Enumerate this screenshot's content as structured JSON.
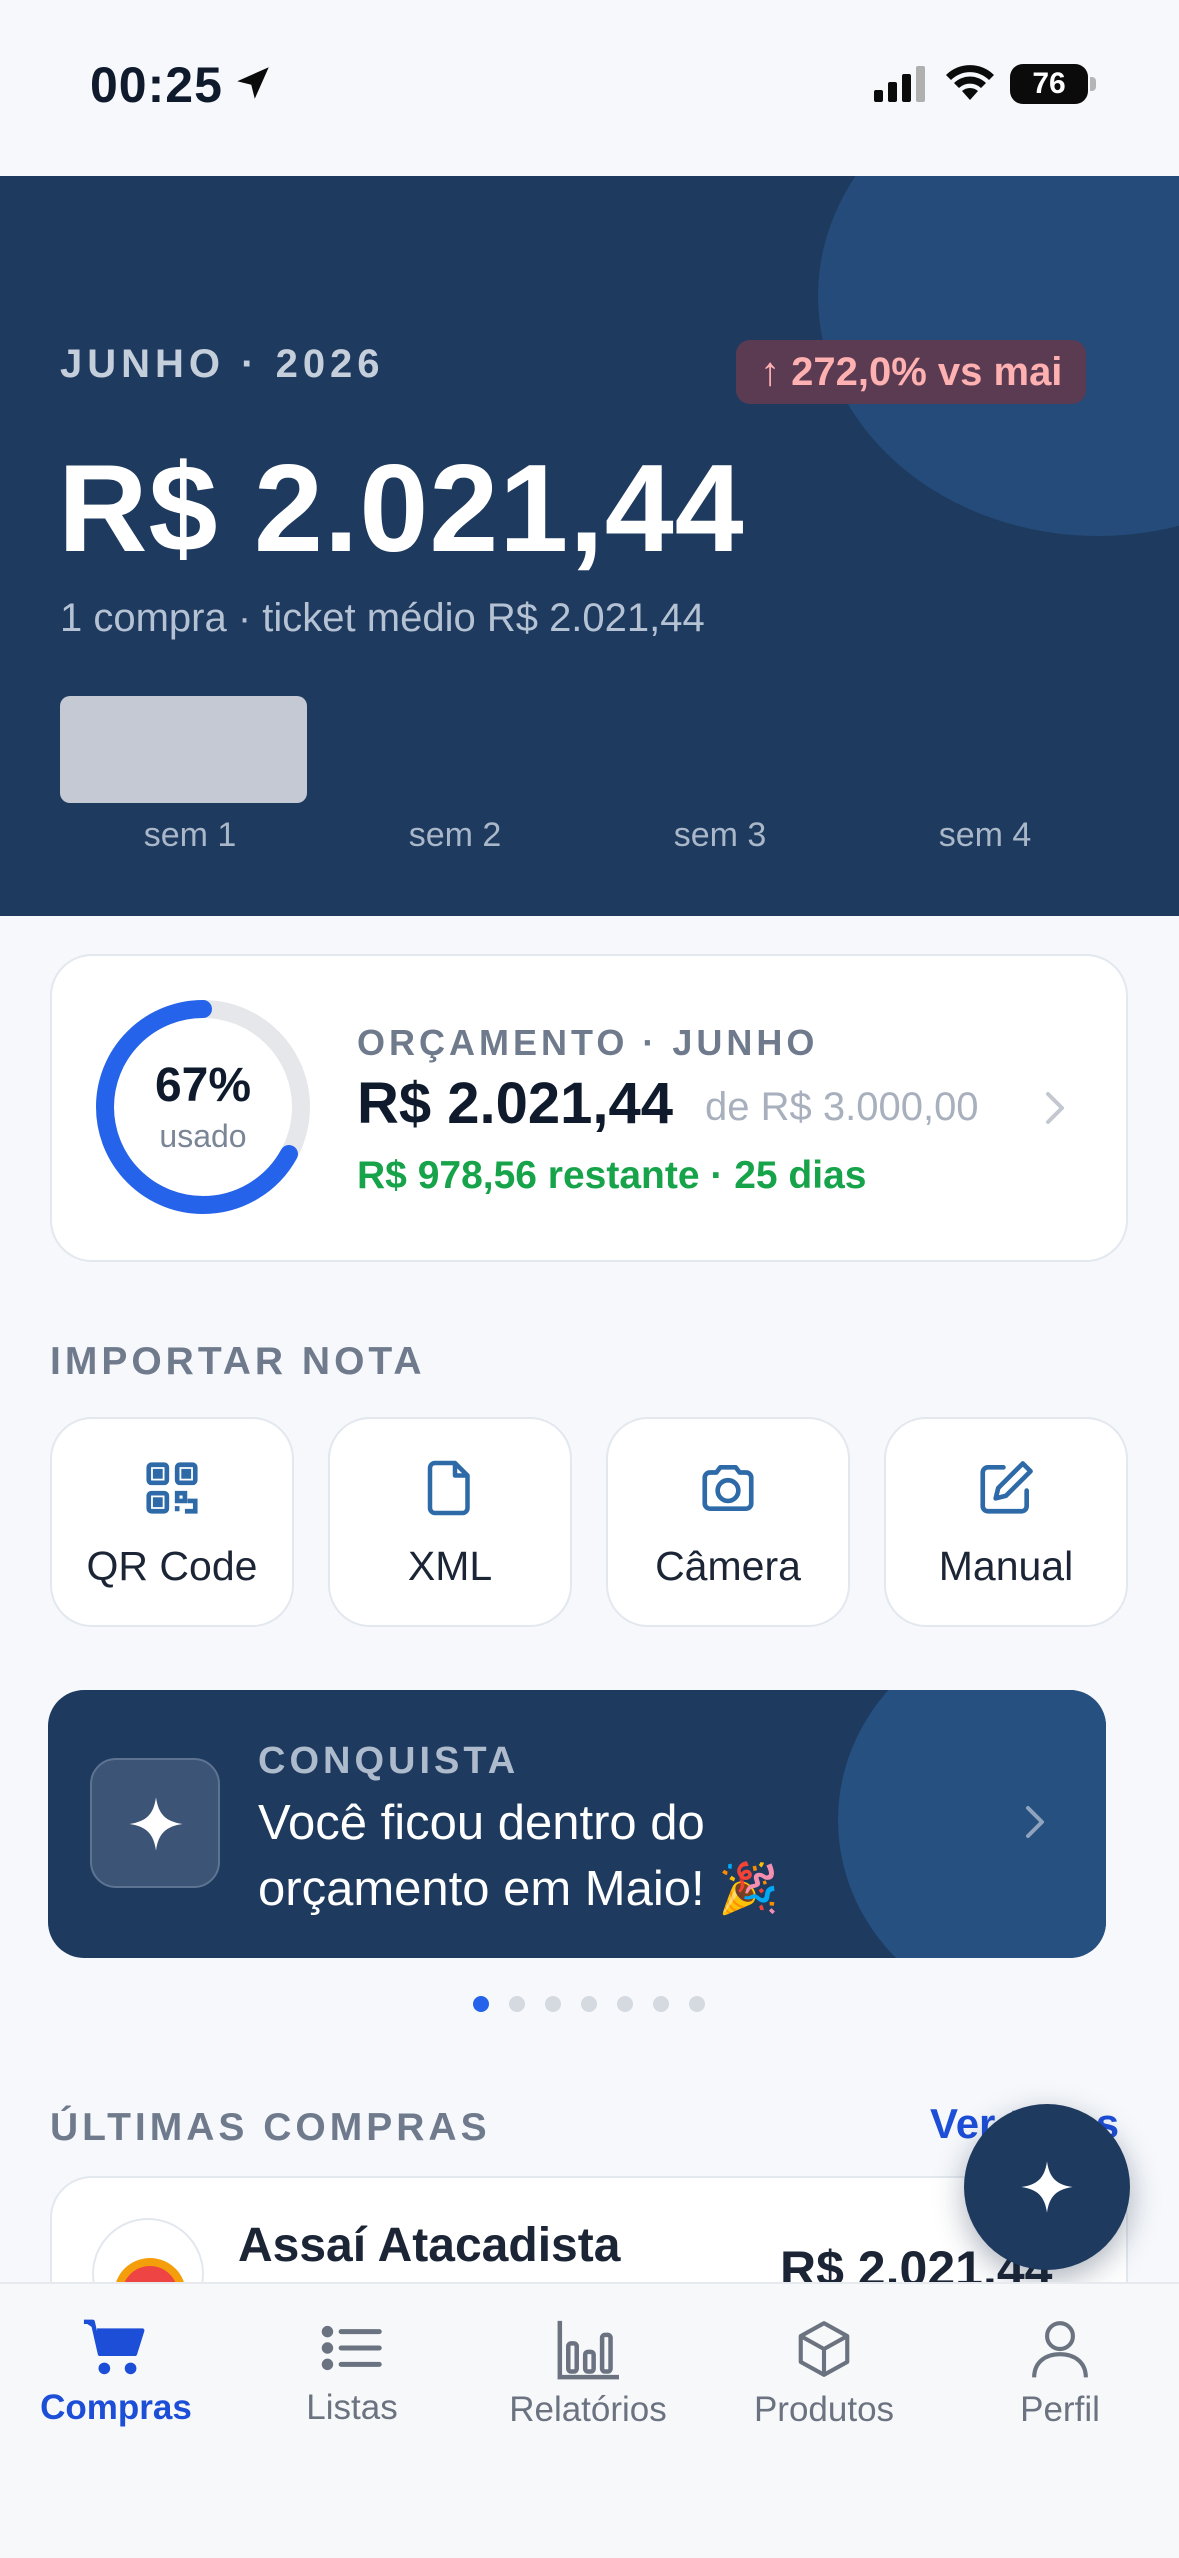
{
  "status_bar": {
    "time": "00:25",
    "battery": "76"
  },
  "hero": {
    "period": "JUNHO · 2026",
    "change_badge": "↑ 272,0% vs mai",
    "total": "R$ 2.021,44",
    "subtitle": "1 compra · ticket médio R$ 2.021,44",
    "weeks": [
      "sem 1",
      "sem 2",
      "sem 3",
      "sem 4"
    ]
  },
  "budget": {
    "percent": "67%",
    "percent_label": "usado",
    "used_fraction": 0.67,
    "title": "ORÇAMENTO · JUNHO",
    "spent": "R$ 2.021,44",
    "of_total": "de R$ 3.000,00",
    "remaining": "R$ 978,56 restante · 25 dias",
    "accent": "#2563eb"
  },
  "import": {
    "title": "IMPORTAR NOTA",
    "options": [
      {
        "label": "QR Code",
        "icon": "qr-code-icon"
      },
      {
        "label": "XML",
        "icon": "file-icon"
      },
      {
        "label": "Câmera",
        "icon": "camera-icon"
      },
      {
        "label": "Manual",
        "icon": "edit-icon"
      }
    ]
  },
  "achievement": {
    "title": "CONQUISTA",
    "text": "Você ficou dentro do orçamento em Maio! 🎉",
    "dots_total": 7,
    "dots_active": 1
  },
  "purchases": {
    "title": "ÚLTIMAS COMPRAS",
    "see_all": "Ver todas",
    "items": [
      {
        "store": "Assaí Atacadista",
        "value": "R$ 2.021,44"
      }
    ]
  },
  "tabs": [
    {
      "label": "Compras",
      "icon": "cart-icon",
      "active": true
    },
    {
      "label": "Listas",
      "icon": "list-icon",
      "active": false
    },
    {
      "label": "Relatórios",
      "icon": "bar-chart-icon",
      "active": false
    },
    {
      "label": "Produtos",
      "icon": "box-icon",
      "active": false
    },
    {
      "label": "Perfil",
      "icon": "user-icon",
      "active": false
    }
  ],
  "colors": {
    "primary": "#1e3a5f",
    "accent": "#2563eb",
    "success": "#16a34a"
  }
}
